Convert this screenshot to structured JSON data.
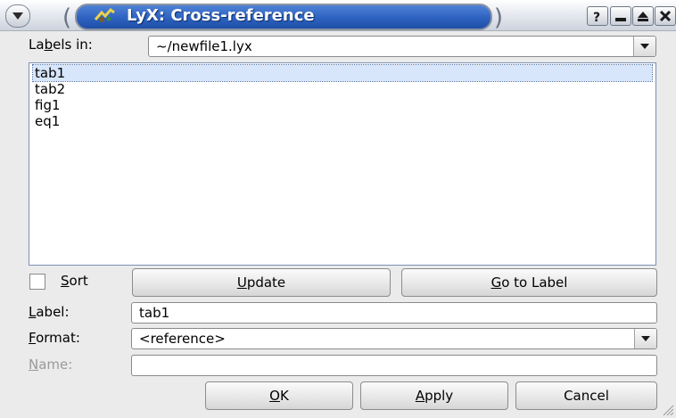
{
  "window": {
    "title": "LyX: Cross-reference",
    "controls": [
      "help-icon",
      "minimize-icon",
      "maximize-icon",
      "close-icon"
    ]
  },
  "labels_in": {
    "label_pre": "La",
    "label_mn": "b",
    "label_post": "els in:",
    "selected": "~/newfile1.lyx"
  },
  "labels_list": {
    "items": [
      {
        "text": "tab1",
        "selected": true
      },
      {
        "text": "tab2",
        "selected": false
      },
      {
        "text": "fig1",
        "selected": false
      },
      {
        "text": "eq1",
        "selected": false
      }
    ]
  },
  "sort": {
    "label_mn": "S",
    "label_post": "ort",
    "checked": false
  },
  "buttons": {
    "update_mn": "U",
    "update_post": "pdate",
    "goto_mn": "G",
    "goto_post": "o to Label",
    "ok_mn": "O",
    "ok_post": "K",
    "apply_mn": "A",
    "apply_post": "pply",
    "cancel": "Cancel"
  },
  "label_field": {
    "label_mn": "L",
    "label_post": "abel:",
    "value": "tab1"
  },
  "format": {
    "label_mn": "F",
    "label_post": "ormat:",
    "selected": "<reference>"
  },
  "name_field": {
    "label_mn": "N",
    "label_post": "ame:",
    "value": "",
    "enabled": false
  },
  "colors": {
    "title_bar_active": "#2e62c0",
    "selection": "#d8e6fb",
    "dialog_bg": "#ebebeb"
  }
}
